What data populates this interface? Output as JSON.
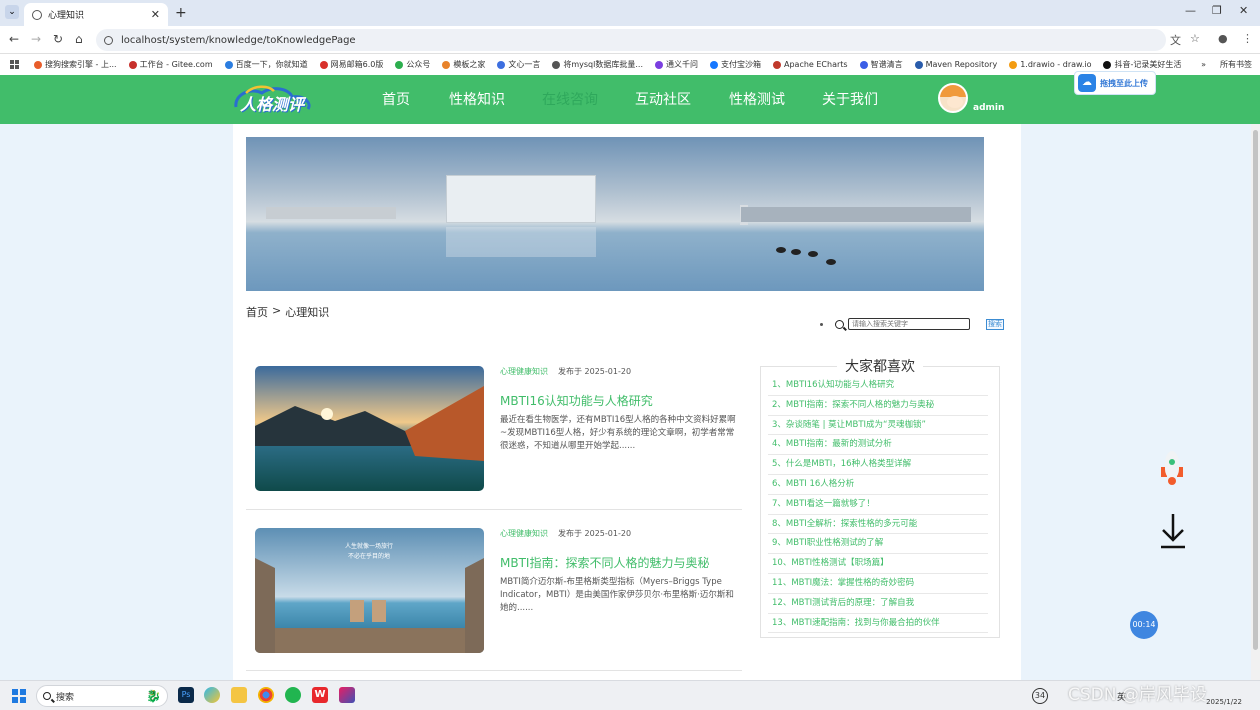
{
  "browser": {
    "tab_title": "心理知识",
    "url": "localhost/system/knowledge/toKnowledgePage",
    "bookmarks": [
      "搜狗搜索引擎 - 上...",
      "工作台 - Gitee.com",
      "百度一下，你就知道",
      "网易邮箱6.0版",
      "公众号",
      "模板之家",
      "文心一言",
      "将mysql数据库批量...",
      "通义千问",
      "支付宝沙箱",
      "Apache ECharts",
      "智谱清言",
      "Maven Repository",
      "1.drawio - draw.io",
      "抖音-记录美好生活"
    ],
    "bookmarks_folder": "所有书签",
    "bookmark_colors": [
      "#e85d2a",
      "#c7302c",
      "#2b7de0",
      "#d8312b",
      "#2cae4e",
      "#e8832a",
      "#3d6fe0",
      "#555555",
      "#7b3fe0",
      "#1677ff",
      "#c0392b",
      "#3b5ee6",
      "#2a5cab",
      "#f39c12",
      "#111111"
    ]
  },
  "site": {
    "logo_text": "人格测评",
    "nav": [
      "首页",
      "性格知识",
      "在线咨询",
      "互动社区",
      "性格测试",
      "关于我们"
    ],
    "active_nav_index": 2,
    "username": "admin",
    "upload_label": "拖拽至此上传"
  },
  "breadcrumb": {
    "home": "首页",
    "sep": ">",
    "current": "心理知识"
  },
  "search": {
    "placeholder": "请输入搜索关键字",
    "button": "搜索"
  },
  "articles": [
    {
      "category": "心理健康知识",
      "date": "发布于 2025-01-20",
      "title": "MBTI16认知功能与人格研究",
      "summary": "最近在看生物医学，还有MBTI16型人格的各种中文资料好累啊~发现MBTI16型人格，好少有系统的理论文章啊，初学者常常很迷惑，不知道从哪里开始学起......"
    },
    {
      "category": "心理健康知识",
      "date": "发布于 2025-01-20",
      "title": "MBTI指南：探索不同人格的魅力与奥秘",
      "summary": "MBTI简介迈尔斯-布里格斯类型指标（Myers–Briggs Type Indicator，MBTI）是由美国作家伊莎贝尔·布里格斯·迈尔斯和她的......",
      "image_caption": [
        "人生就像一场旅行",
        "不必在乎目的地"
      ]
    }
  ],
  "popular": {
    "heading": "大家都喜欢",
    "items": [
      "1、MBTI16认知功能与人格研究",
      "2、MBTI指南：探索不同人格的魅力与奥秘",
      "3、杂谈随笔 | 莫让MBTI成为“灵魂枷锁”",
      "4、MBTI指南：最新的测试分析",
      "5、什么是MBTI，16种人格类型详解",
      "6、MBTI 16人格分析",
      "7、MBTI看这一篇就够了！",
      "8、MBTI全解析：探索性格的多元可能",
      "9、MBTI职业性格测试的了解",
      "10、MBTI性格测试【职场篇】",
      "11、MBTI魔法：掌握性格的奇妙密码",
      "12、MBTI测试背后的原理：了解自我",
      "13、MBTI速配指南：找到与你最合拍的伙伴"
    ]
  },
  "widgets": {
    "timer": "00:14"
  },
  "taskbar": {
    "search": "搜索",
    "badge": "34",
    "tray_lang": "英",
    "date": "2025/1/22"
  },
  "watermark": "CSDN @岸风毕设",
  "colors": {
    "accent": "#41bd6a",
    "upload_blue": "#2b83e6"
  },
  "icons": [
    "windows-start-icon",
    "search-icon",
    "photoshop-icon",
    "browser-icon",
    "folder-icon",
    "chrome-icon",
    "wechat-icon",
    "wps-icon",
    "jetbrains-icon",
    "rocket-icon",
    "download-arrow-icon"
  ]
}
